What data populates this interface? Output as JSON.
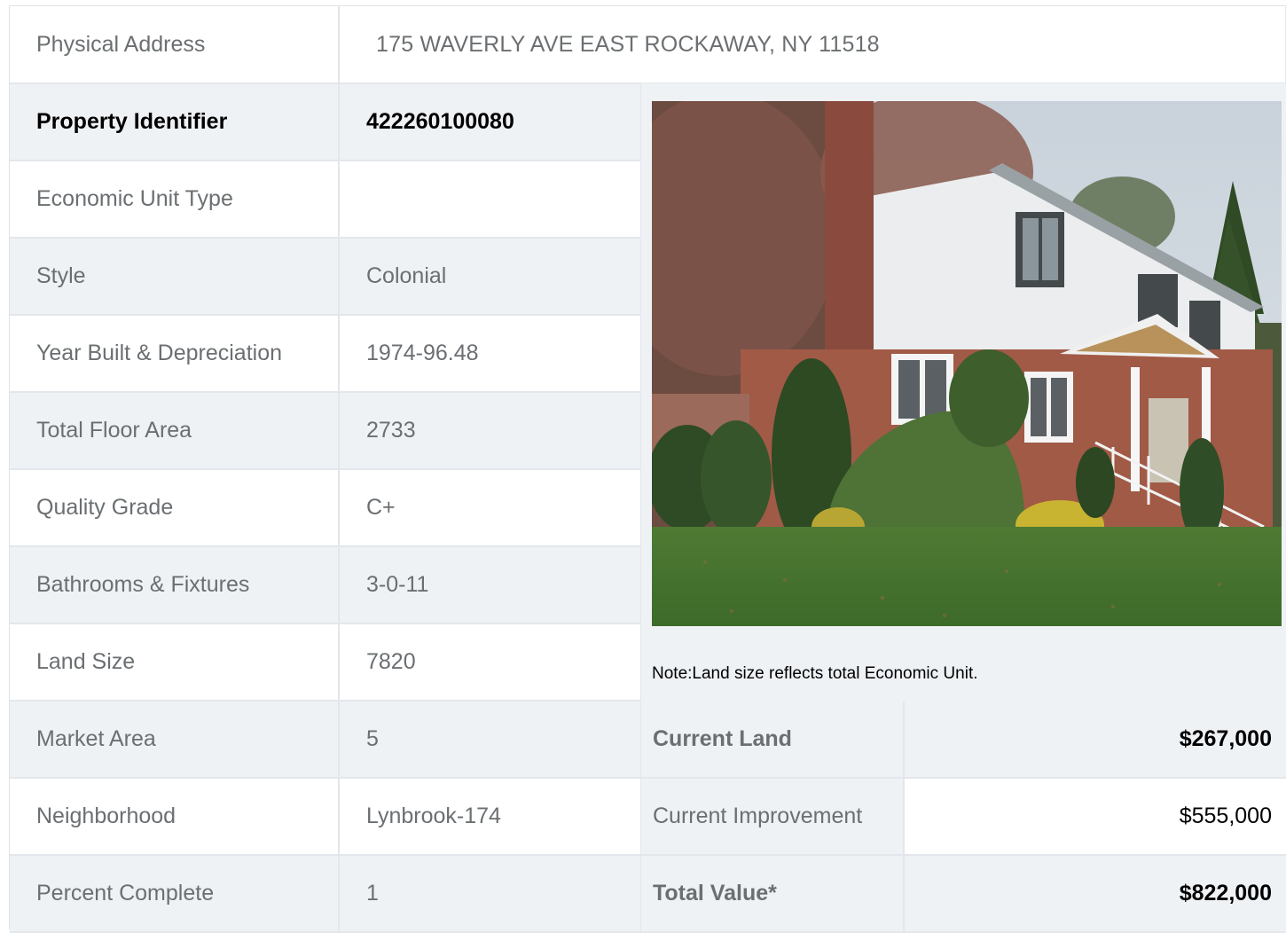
{
  "address": {
    "label": "Physical Address",
    "value": "175  WAVERLY AVE  EAST ROCKAWAY, NY  11518"
  },
  "details": [
    {
      "label": "Property Identifier",
      "value": "422260100080"
    },
    {
      "label": "Economic Unit Type",
      "value": ""
    },
    {
      "label": "Style",
      "value": "Colonial"
    },
    {
      "label": "Year Built & Depreciation",
      "value": "1974-96.48"
    },
    {
      "label": "Total Floor Area",
      "value": "2733"
    },
    {
      "label": "Quality Grade",
      "value": "C+"
    },
    {
      "label": "Bathrooms & Fixtures",
      "value": "3-0-11"
    },
    {
      "label": "Land Size",
      "value": "7820"
    },
    {
      "label": "Market Area",
      "value": "5"
    },
    {
      "label": "Neighborhood",
      "value": "Lynbrook-174"
    },
    {
      "label": "Percent Complete",
      "value": "1"
    }
  ],
  "note": "Note:Land size reflects total Economic Unit.",
  "valuation": [
    {
      "label": "Current Land",
      "value": "$267,000"
    },
    {
      "label": "Current Improvement",
      "value": "$555,000"
    },
    {
      "label": "Total Value*",
      "value": "$822,000"
    }
  ],
  "photo": {
    "subject": "house-photo"
  }
}
